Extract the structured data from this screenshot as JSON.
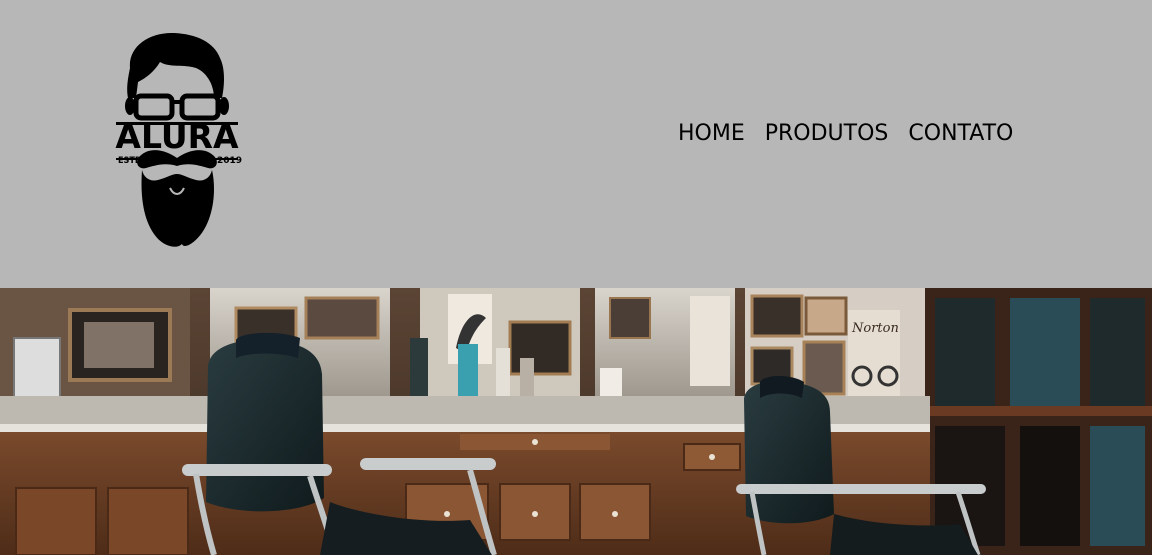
{
  "brand": {
    "name": "ALURA",
    "estd_label": "ESTD",
    "year": "2019"
  },
  "nav": {
    "items": [
      {
        "label": "HOME"
      },
      {
        "label": "PRODUTOS"
      },
      {
        "label": "CONTATO"
      }
    ]
  },
  "hero": {
    "sign_text": "Norton"
  },
  "colors": {
    "header_bg": "#b7b7b7",
    "nav_text": "#000000",
    "wood": "#6e4027",
    "chair_leather": "#1a2a2e"
  }
}
